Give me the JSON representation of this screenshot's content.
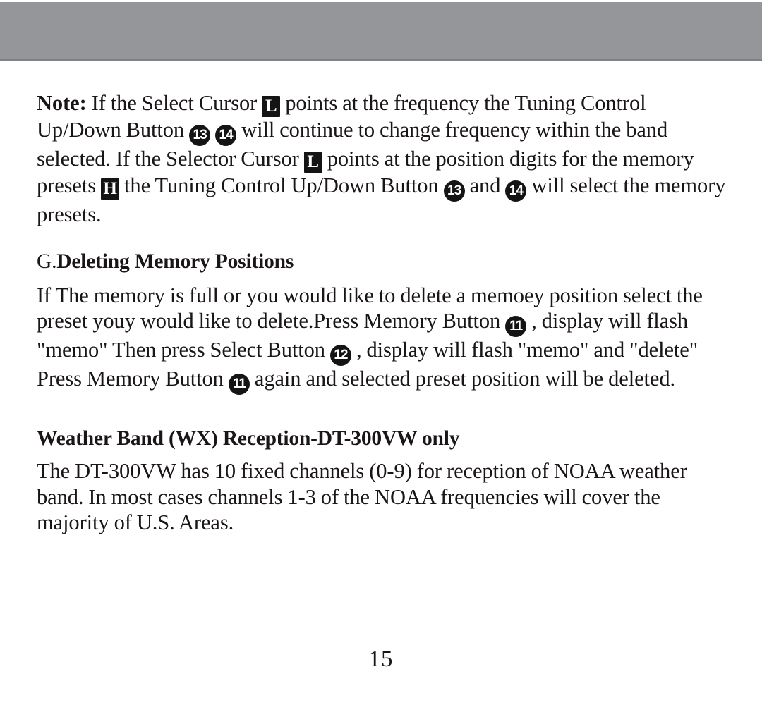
{
  "document": {
    "page_number": "15",
    "header_band_color": "#949699",
    "badge_color": "#141414",
    "text_color": "#1a1518"
  },
  "note": {
    "label": "Note:",
    "line1_a": " If the Select Cursor ",
    "badge_L1": "L",
    "line1_b": " points at the frequency the Tuning Control Up/Down Button ",
    "badge_13a": "13",
    "badge_14a": "14",
    "line2": " will continue to change frequency within the band selected. If the Selector Cursor ",
    "badge_L2": "L",
    "line3": " points at the position digits for the memory presets ",
    "badge_H": "H",
    "line4": " the Tuning Control Up/Down Button ",
    "badge_13b": "13",
    "line5": " and ",
    "badge_14b": "14",
    "line6": " will select the memory presets."
  },
  "section_g": {
    "heading_lead": "G.",
    "heading_title": "Deleting Memory Positions",
    "body_a": "If The memory is full or you would like to delete a memoey position select the preset youy would like to delete.Press Memory Button ",
    "badge_11a": "11",
    "body_b": " , display will flash \"memo\"  Then press Select Button ",
    "badge_12": "12",
    "body_c": " , display will flash \"memo\" and \"delete\" Press Memory Button ",
    "badge_11b": "11",
    "body_d": " again and selected preset  position will be deleted."
  },
  "section_wx": {
    "heading": "Weather Band (WX) Reception-DT-300VW only",
    "body": "The DT-300VW has 10 fixed channels (0-9) for reception of NOAA weather band. In most cases channels 1-3 of the NOAA frequencies will cover the majority of U.S. Areas."
  }
}
